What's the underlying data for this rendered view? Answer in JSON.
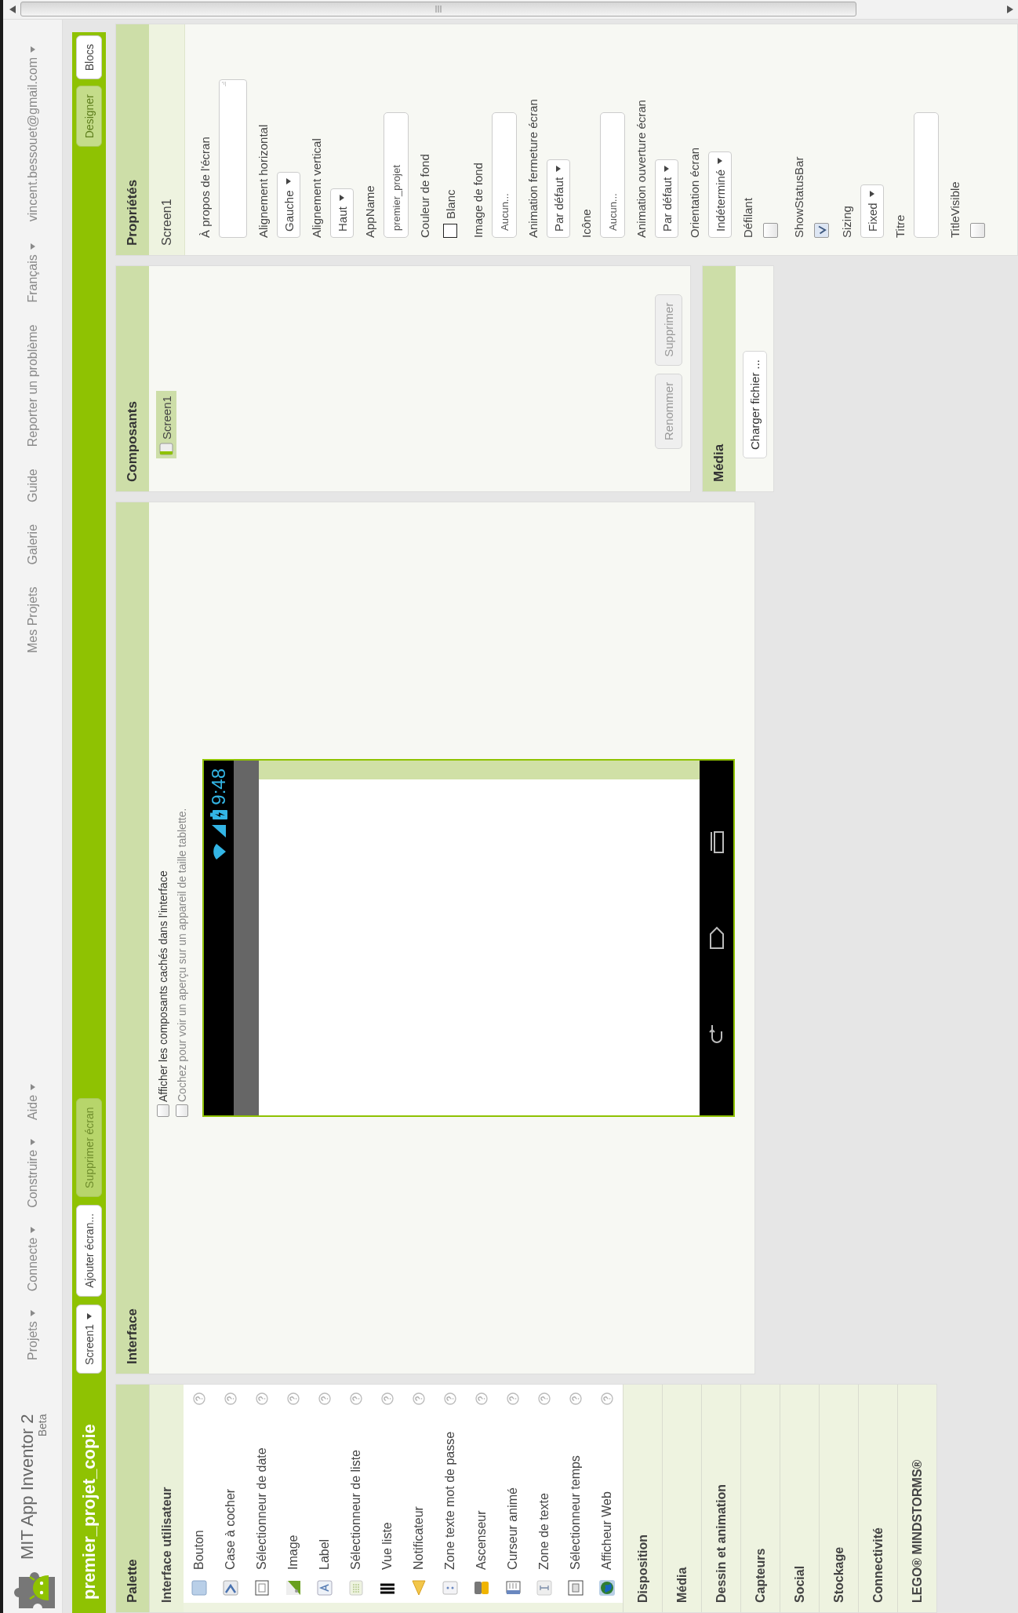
{
  "topbar": {
    "brand": "MIT App Inventor 2",
    "badge": "Beta",
    "menus": [
      {
        "label": "Projets",
        "dropdown": true
      },
      {
        "label": "Connecte",
        "dropdown": true
      },
      {
        "label": "Construire",
        "dropdown": true
      },
      {
        "label": "Aide",
        "dropdown": true
      }
    ],
    "links": [
      {
        "label": "Mes Projets",
        "dropdown": false
      },
      {
        "label": "Galerie",
        "dropdown": false
      },
      {
        "label": "Guide",
        "dropdown": false
      },
      {
        "label": "Reporter un problème",
        "dropdown": false
      },
      {
        "label": "Français",
        "dropdown": true
      },
      {
        "label": "vincent.bessouet@gmail.com",
        "dropdown": true
      }
    ]
  },
  "toolbar": {
    "project": "premier_projet_copie",
    "screen": {
      "label": "Screen1",
      "dropdown": true
    },
    "actions": [
      {
        "label": "Ajouter écran...",
        "disabled": false
      },
      {
        "label": "Supprimer écran",
        "disabled": true
      }
    ],
    "views": [
      {
        "label": "Designer",
        "selected": true
      },
      {
        "label": "Blocs",
        "selected": false
      }
    ]
  },
  "palette": {
    "title": "Palette",
    "categories": [
      {
        "label": "Interface utilisateur",
        "expanded": true,
        "items": [
          "Bouton",
          "Case à cocher",
          "Sélectionneur de date",
          "Image",
          "Label",
          "Sélectionneur de liste",
          "Vue liste",
          "Notificateur",
          "Zone texte mot de passe",
          "Ascenseur",
          "Curseur animé",
          "Zone de texte",
          "Sélectionneur temps",
          "Afficheur Web"
        ]
      },
      {
        "label": "Disposition",
        "expanded": false
      },
      {
        "label": "Média",
        "expanded": false
      },
      {
        "label": "Dessin et animation",
        "expanded": false
      },
      {
        "label": "Capteurs",
        "expanded": false
      },
      {
        "label": "Social",
        "expanded": false
      },
      {
        "label": "Stockage",
        "expanded": false
      },
      {
        "label": "Connectivité",
        "expanded": false
      },
      {
        "label": "LEGO® MINDSTORMS®",
        "expanded": false
      }
    ]
  },
  "viewer": {
    "title": "Interface",
    "options": [
      {
        "label": "Afficher les composants cachés dans l’interface",
        "checked": false,
        "disabled": false
      },
      {
        "label": "Cochez pour voir un aperçu sur un appareil de taille tablette.",
        "checked": false,
        "disabled": true
      }
    ],
    "phone": {
      "time": "9:48"
    }
  },
  "components": {
    "title": "Composants",
    "tree": [
      {
        "label": "Screen1",
        "selected": true
      }
    ],
    "buttons": [
      {
        "label": "Renommer",
        "disabled": true
      },
      {
        "label": "Supprimer",
        "disabled": true
      }
    ]
  },
  "media": {
    "title": "Média",
    "button": "Charger fichier ..."
  },
  "properties": {
    "title": "Propriétés",
    "component": "Screen1",
    "items": [
      {
        "label": "À propos de l'écran",
        "kind": "textarea"
      },
      {
        "label": "Alignement horizontal",
        "kind": "dropdown",
        "value": "Gauche"
      },
      {
        "label": "Alignement vertical",
        "kind": "dropdown",
        "value": "Haut"
      },
      {
        "label": "AppName",
        "kind": "textbox",
        "value": "premier_projet"
      },
      {
        "label": "Couleur de fond",
        "kind": "color",
        "value": "Blanc",
        "color": "#ffffff"
      },
      {
        "label": "Image de fond",
        "kind": "textbox",
        "value": "Aucun..."
      },
      {
        "label": "Animation fermeture écran",
        "kind": "dropdown",
        "value": "Par défaut"
      },
      {
        "label": "Icône",
        "kind": "textbox",
        "value": "Aucun..."
      },
      {
        "label": "Animation ouverture écran",
        "kind": "dropdown",
        "value": "Par défaut"
      },
      {
        "label": "Orientation écran",
        "kind": "dropdown",
        "value": "Indéterminé"
      },
      {
        "label": "Défilant",
        "kind": "checkbox",
        "checked": false
      },
      {
        "label": "ShowStatusBar",
        "kind": "checkbox",
        "checked": true
      },
      {
        "label": "Sizing",
        "kind": "dropdown",
        "value": "Fixed"
      },
      {
        "label": "Titre",
        "kind": "textbox"
      },
      {
        "label": "TitleVisible",
        "kind": "checkbox",
        "checked": false
      }
    ]
  }
}
